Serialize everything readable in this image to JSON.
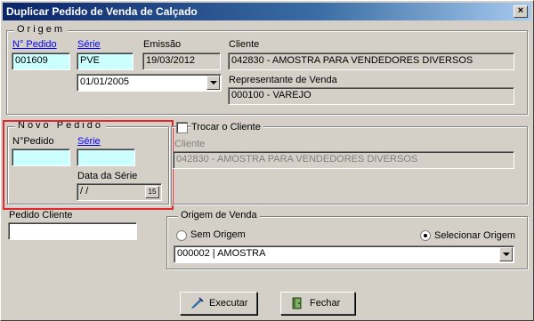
{
  "window": {
    "title": "Duplicar Pedido de Venda de Calçado",
    "close_label": "×"
  },
  "origem": {
    "legend": "Origem",
    "n_pedido_label": "N° Pedido",
    "n_pedido_value": "001609",
    "serie_label": "Série",
    "serie_value": "PVE",
    "emissao_label": "Emissão",
    "emissao_value": "19/03/2012",
    "cliente_label": "Cliente",
    "cliente_value": "042830 - AMOSTRA PARA VENDEDORES DIVERSOS",
    "data_value": "01/01/2005",
    "representante_label": "Representante de Venda",
    "representante_value": "000100 - VAREJO"
  },
  "novo_pedido": {
    "legend": "Novo Pedido",
    "n_pedido_label": "N°Pedido",
    "serie_label": "Série",
    "data_serie_label": "Data da Série",
    "data_serie_value": " /  /",
    "cal_label": "15"
  },
  "trocar": {
    "checkbox_label": "Trocar o Cliente",
    "cliente_label": "Cliente",
    "cliente_value": "042830 - AMOSTRA PARA VENDEDORES DIVERSOS"
  },
  "pedido_cliente": {
    "label": "Pedido Cliente",
    "value": ""
  },
  "origem_venda": {
    "legend": "Origem de Venda",
    "sem_origem_label": "Sem Origem",
    "selecionar_label": "Selecionar Origem",
    "selected": "selecionar",
    "origem_value": "000002 | AMOSTRA"
  },
  "buttons": {
    "executar": "Executar",
    "fechar": "Fechar"
  },
  "colors": {
    "highlight": "#e0282e",
    "titlebar": "#0a246a",
    "field_cyan": "#ccffff"
  }
}
